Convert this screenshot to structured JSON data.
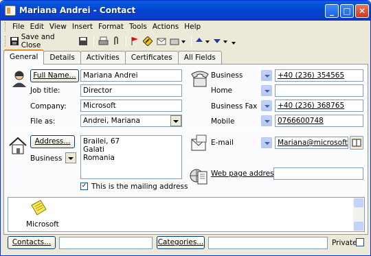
{
  "window": {
    "title": "Mariana Andrei - Contact",
    "min": "_",
    "max": "□",
    "close": "✕"
  },
  "menu": [
    "File",
    "Edit",
    "View",
    "Insert",
    "Format",
    "Tools",
    "Actions",
    "Help"
  ],
  "toolbar": {
    "save_close": "Save and Close"
  },
  "tabs": [
    "General",
    "Details",
    "Activities",
    "Certificates",
    "All Fields"
  ],
  "general": {
    "full_name_btn": "Full Name...",
    "full_name": "Mariana Andrei",
    "job_title_lbl": "Job title:",
    "job_title": "Director",
    "company_lbl": "Company:",
    "company": "Microsoft",
    "file_as_lbl": "File as:",
    "file_as": "Andrei, Mariana",
    "address_btn": "Address...",
    "address_type": "Business",
    "address_lines": [
      "Brailei, 67",
      "Galati",
      "Romania"
    ],
    "mailing_label": "This is the mailing address",
    "phones": [
      {
        "type": "Business",
        "value": "+40 (236) 354565"
      },
      {
        "type": "Home",
        "value": ""
      },
      {
        "type": "Business Fax",
        "value": "+40 (236) 368765"
      },
      {
        "type": "Mobile",
        "value": "0766600748"
      }
    ],
    "email_lbl": "E-mail",
    "email": "Mariana@microsoft.ro",
    "web_lbl": "Web page address:",
    "web": "",
    "notes_icon_caption": "Microsoft"
  },
  "footer": {
    "contacts_btn": "Contacts...",
    "categories_btn": "Categories...",
    "private_lbl": "Private"
  },
  "colors": {
    "title_bar": "#0346d6",
    "tab_highlight": "#e68b2c"
  }
}
